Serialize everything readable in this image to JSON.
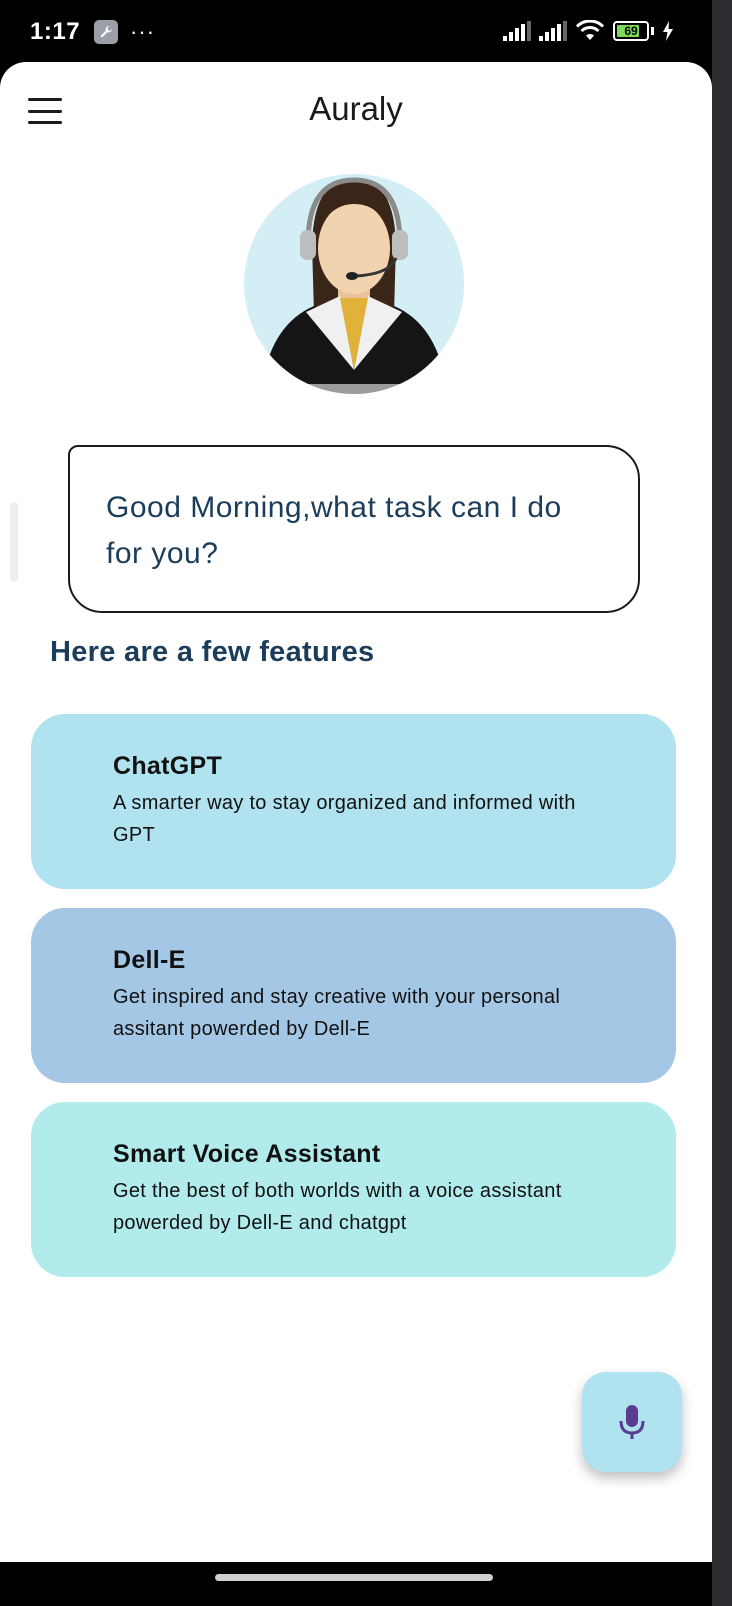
{
  "status_bar": {
    "time": "1:17",
    "dots": "···",
    "battery_level": "69",
    "icons": [
      "wrench-icon",
      "signal-icon",
      "signal-icon",
      "wifi-icon",
      "battery-icon",
      "charging-icon"
    ]
  },
  "app_bar": {
    "title": "Auraly",
    "menu_icon": "hamburger-menu-icon"
  },
  "assistant": {
    "avatar_icon": "assistant-headset-avatar",
    "greeting": "Good Morning,what task can I do for you?"
  },
  "features": {
    "heading": "Here are a few features",
    "items": [
      {
        "title": "ChatGPT",
        "description": "A smarter way to stay organized and informed with GPT",
        "color": "#b0e3ef"
      },
      {
        "title": "Dell-E",
        "description": "Get inspired and stay creative with your personal assitant powerded by Dell-E",
        "color": "#a5c7e6"
      },
      {
        "title": "Smart Voice Assistant",
        "description": "Get the best of both worlds with a voice assistant powerded by Dell-E and chatgpt",
        "color": "#b1ebeb"
      }
    ]
  },
  "fab": {
    "icon": "microphone-icon",
    "color": "#b0e3ef",
    "icon_color": "#5a3d91"
  },
  "colors": {
    "text_dark_blue": "#1c3d5a",
    "background": "#ffffff"
  }
}
